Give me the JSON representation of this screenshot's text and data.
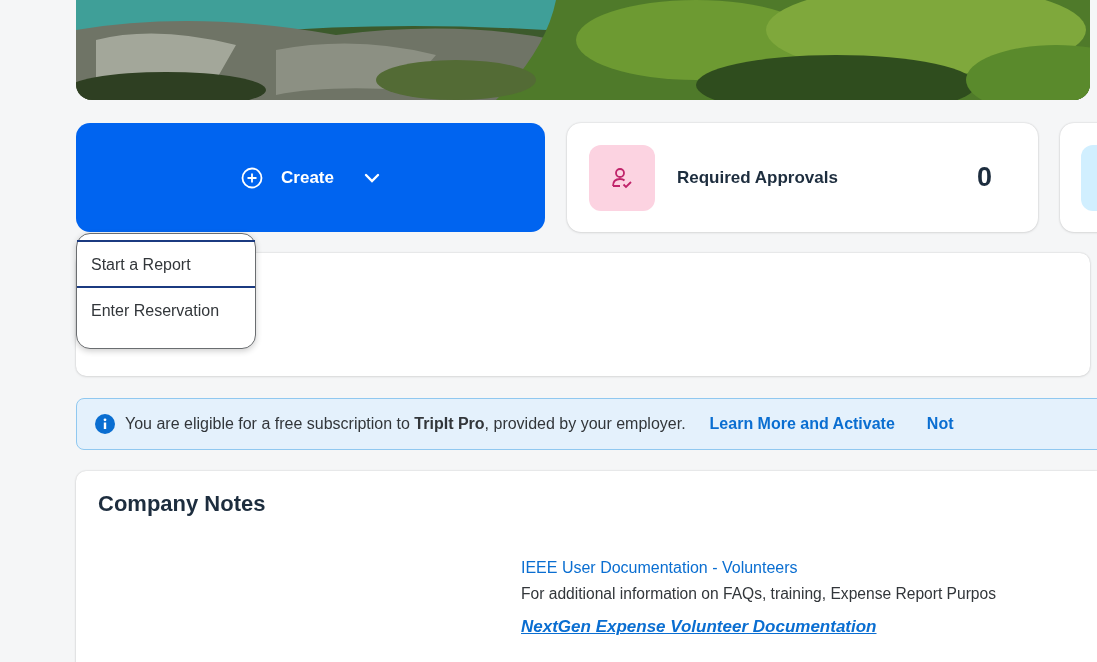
{
  "create_button": {
    "label": "Create"
  },
  "create_menu": {
    "items": [
      {
        "label": "Start a Report"
      },
      {
        "label": "Enter Reservation"
      }
    ]
  },
  "tiles": [
    {
      "label": "Required Approvals",
      "count": "0"
    }
  ],
  "banner": {
    "message": "You are eligible for a free subscription to **TripIt Pro**, provided by your employer.",
    "links": [
      "Learn More and Activate",
      "Not"
    ]
  },
  "company_notes": {
    "title": "Company Notes",
    "link": "IEEE User Documentation - Volunteers",
    "description": "For additional information on FAQs, training, Expense Report Purpos",
    "document_link": "NextGen Expense Volunteer Documentation"
  }
}
